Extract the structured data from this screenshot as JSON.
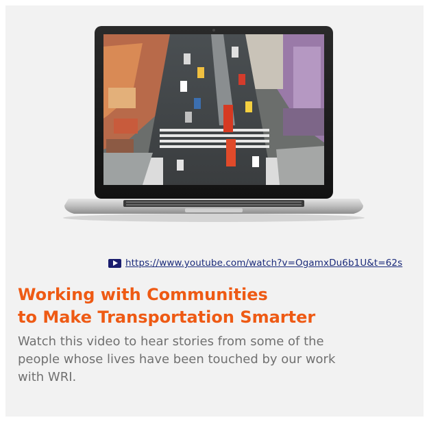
{
  "video": {
    "link_text": "https://www.youtube.com/watch?v=OgamxDu6b1U&t=62s",
    "play_icon": "video-play-icon"
  },
  "article": {
    "title_line1": "Working with Communities",
    "title_line2": "to Make Transportation Smarter",
    "description_line1": "Watch this video to hear stories from some of the",
    "description_line2": "people whose lives have been touched by our work",
    "description_line3": "with WRI."
  },
  "colors": {
    "background": "#f2f2f2",
    "title": "#ee5a14",
    "link": "#1a2a7a",
    "play_icon": "#1a1d6e",
    "body_text": "#707070"
  }
}
